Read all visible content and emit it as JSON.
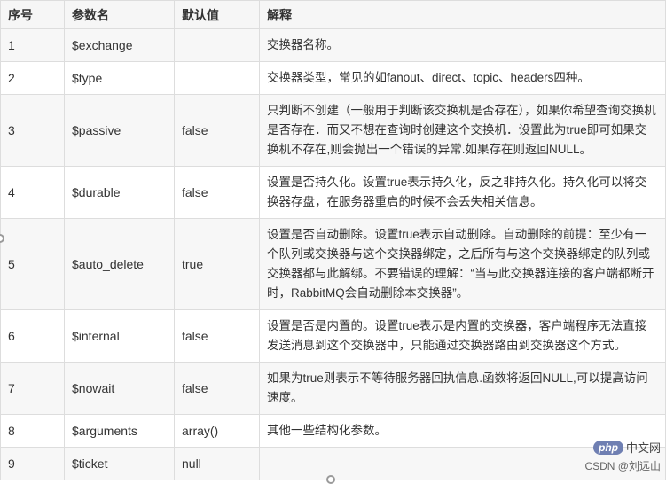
{
  "table": {
    "headers": [
      "序号",
      "参数名",
      "默认值",
      "解释"
    ],
    "rows": [
      {
        "idx": "1",
        "name": "$exchange",
        "default": "",
        "desc": "交换器名称。"
      },
      {
        "idx": "2",
        "name": "$type",
        "default": "",
        "desc": "交换器类型，常见的如fanout、direct、topic、headers四种。"
      },
      {
        "idx": "3",
        "name": "$passive",
        "default": "false",
        "desc": "只判断不创建（一般用于判断该交换机是否存在），如果你希望查询交换机是否存在．而又不想在查询时创建这个交换机．设置此为true即可如果交换机不存在,则会抛出一个错误的异常.如果存在则返回NULL。"
      },
      {
        "idx": "4",
        "name": "$durable",
        "default": "false",
        "desc": "设置是否持久化。设置true表示持久化，反之非持久化。持久化可以将交换器存盘，在服务器重启的时候不会丢失相关信息。"
      },
      {
        "idx": "5",
        "name": "$auto_delete",
        "default": "true",
        "desc": "设置是否自动删除。设置true表示自动删除。自动删除的前提：至少有一个队列或交换器与这个交换器绑定，之后所有与这个交换器绑定的队列或交换器都与此解绑。不要错误的理解：“当与此交换器连接的客户端都断开时，RabbitMQ会自动删除本交换器”。"
      },
      {
        "idx": "6",
        "name": "$internal",
        "default": "false",
        "desc": "设置是否是内置的。设置true表示是内置的交换器，客户端程序无法直接发送消息到这个交换器中，只能通过交换器路由到交换器这个方式。"
      },
      {
        "idx": "7",
        "name": "$nowait",
        "default": "false",
        "desc": "如果为true则表示不等待服务器回执信息.函数将返回NULL,可以提高访问速度。"
      },
      {
        "idx": "8",
        "name": "$arguments",
        "default": "array()",
        "desc": "其他一些结构化参数。"
      },
      {
        "idx": "9",
        "name": "$ticket",
        "default": "null",
        "desc": ""
      }
    ]
  },
  "watermark": {
    "logo_text": "php",
    "site_text": "中文网",
    "author_text": "CSDN @刘远山"
  }
}
